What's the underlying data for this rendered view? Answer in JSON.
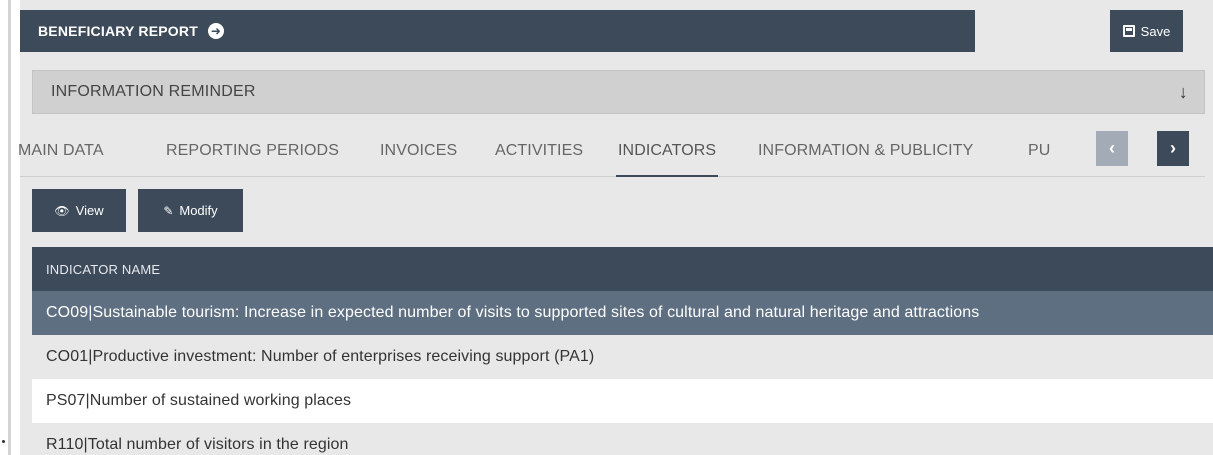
{
  "header": {
    "title": "BENEFICIARY REPORT",
    "save_label": "Save"
  },
  "reminder": {
    "label": "INFORMATION REMINDER"
  },
  "tabs": [
    {
      "label": "MAIN DATA"
    },
    {
      "label": "REPORTING PERIODS"
    },
    {
      "label": "INVOICES"
    },
    {
      "label": "ACTIVITIES"
    },
    {
      "label": "INDICATORS"
    },
    {
      "label": "INFORMATION & PUBLICITY"
    },
    {
      "label": "PU"
    }
  ],
  "actions": {
    "view_label": "View",
    "modify_label": "Modify"
  },
  "table": {
    "header": "INDICATOR NAME",
    "rows": [
      {
        "text": "CO09|Sustainable tourism: Increase in expected number of visits to supported sites of cultural and natural heritage and attractions"
      },
      {
        "text": "CO01|Productive investment: Number of enterprises receiving support (PA1)"
      },
      {
        "text": "PS07|Number of sustained working places"
      },
      {
        "text": "R110|Total number of visitors in the region"
      }
    ]
  },
  "colors": {
    "primary": "#3c4a5a",
    "selected_row": "#5e6f82",
    "disabled_nav": "#a3acb6"
  }
}
